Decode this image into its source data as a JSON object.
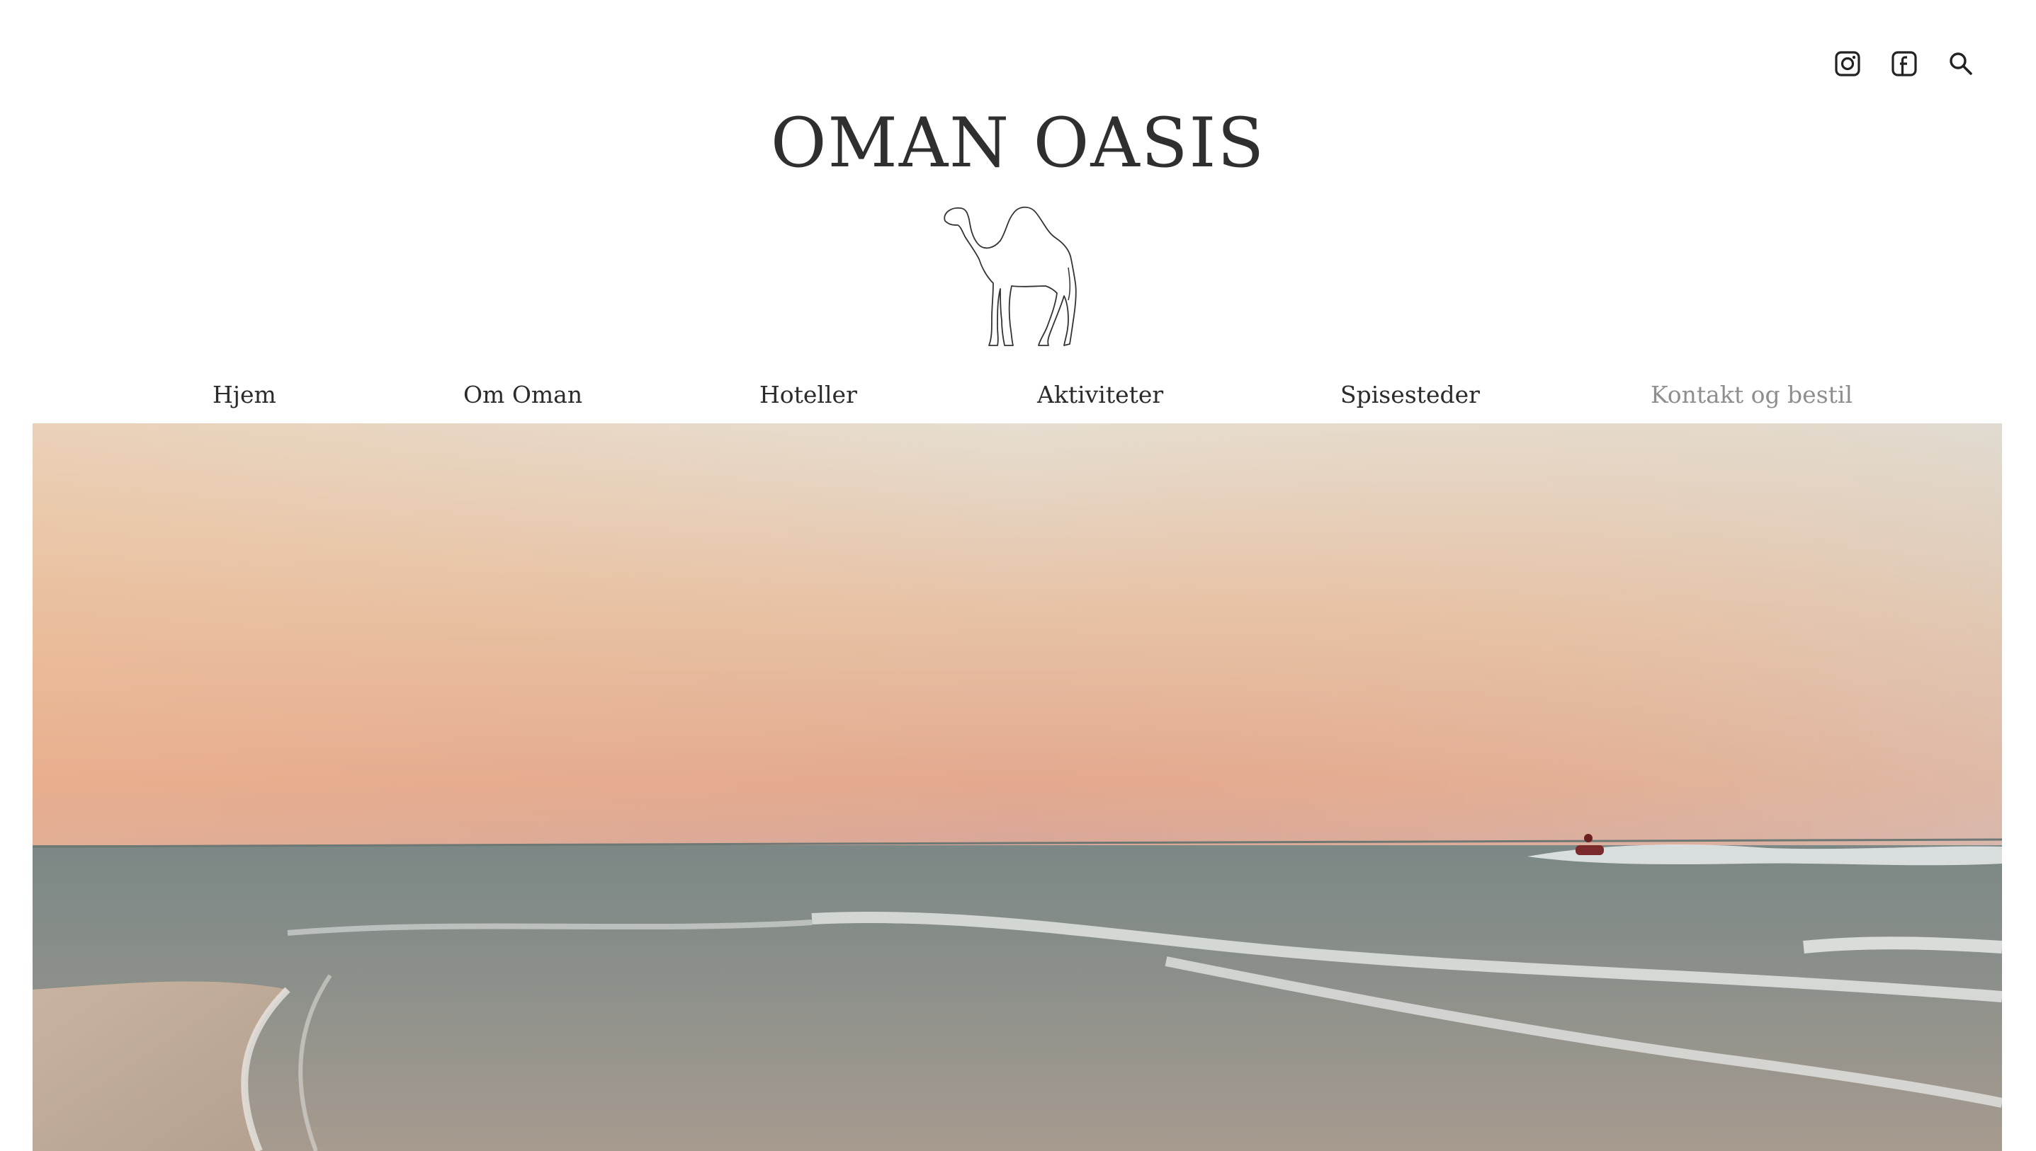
{
  "header": {
    "site_title": "OMAN OASIS"
  },
  "top_icons": [
    {
      "name": "instagram-icon"
    },
    {
      "name": "facebook-icon"
    },
    {
      "name": "search-icon"
    }
  ],
  "nav": {
    "items": [
      {
        "label": "Hjem"
      },
      {
        "label": "Om Oman"
      },
      {
        "label": "Hoteller"
      },
      {
        "label": "Aktiviteter"
      },
      {
        "label": "Spisesteder"
      },
      {
        "label": "Kontakt og bestil"
      }
    ]
  },
  "colors": {
    "text": "#2b2b2b",
    "nav_muted": "#8e8e8e",
    "sky_top": "#e9e3d8",
    "sky_horizon": "#e6b59a",
    "sea": "#7f8a86"
  }
}
